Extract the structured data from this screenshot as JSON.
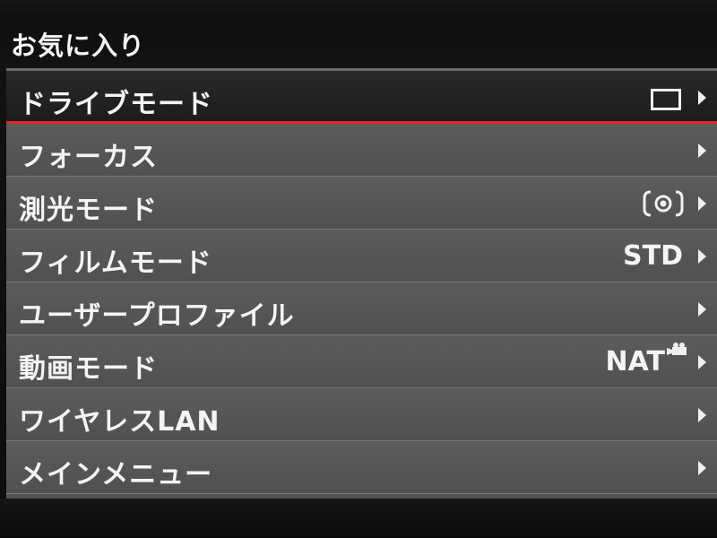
{
  "header": {
    "title": "お気に入り"
  },
  "menu": {
    "items": [
      {
        "label": "ドライブモード",
        "value": "",
        "icon": "single-frame-icon"
      },
      {
        "label": "フォーカス",
        "value": ""
      },
      {
        "label": "測光モード",
        "value": "",
        "icon": "metering-icon"
      },
      {
        "label": "フィルムモード",
        "value": "STD"
      },
      {
        "label": "ユーザープロファイル",
        "value": ""
      },
      {
        "label": "動画モード",
        "value": "NAT",
        "icon": "movie-camera-icon"
      },
      {
        "label": "ワイヤレスLAN",
        "value": ""
      },
      {
        "label": "メインメニュー",
        "value": ""
      }
    ],
    "selected_index": 0
  },
  "colors": {
    "highlight_underline": "#e0262b",
    "row_background": "#545454",
    "selected_background": "#1c1c1c"
  }
}
